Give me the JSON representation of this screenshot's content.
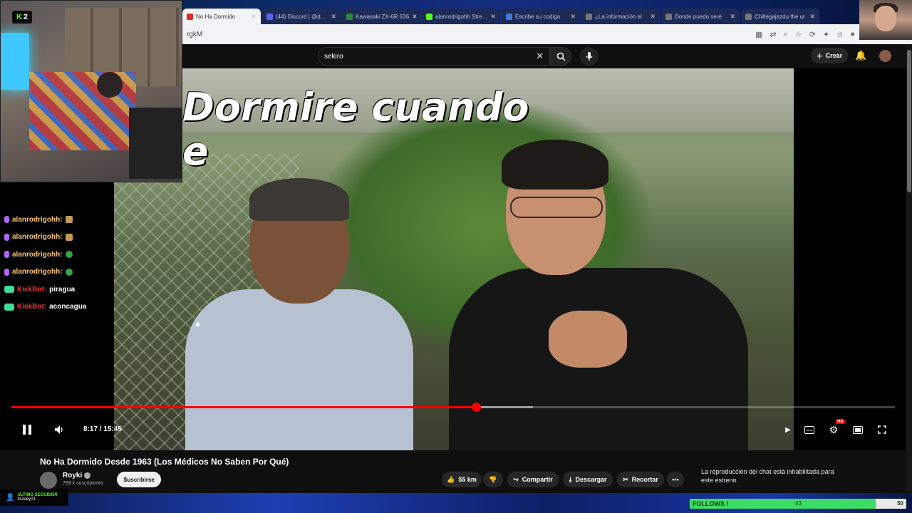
{
  "browser": {
    "tabs": [
      {
        "label": "No Ha Dormido",
        "active": true,
        "color": "#e02a2a"
      },
      {
        "label": "(44) Discord | @d...",
        "active": false,
        "color": "#5865f2"
      },
      {
        "label": "Kawasaki ZX-6R 636",
        "active": false,
        "color": "#2b8a3e"
      },
      {
        "label": "alanrodrigohh Stre...",
        "active": false,
        "color": "#53fc18"
      },
      {
        "label": "Escribe su codigo",
        "active": false,
        "color": "#3a7bd5"
      },
      {
        "label": "¿La información el",
        "active": false,
        "color": "#777777"
      },
      {
        "label": "Donde puedo seré",
        "active": false,
        "color": "#777777"
      },
      {
        "label": "Chillegajazdu the ur",
        "active": false,
        "color": "#777777"
      }
    ],
    "url_fragment": "rgkM"
  },
  "youtube": {
    "search_query": "sekiro",
    "create_label": "Crear"
  },
  "video": {
    "overlay_text_line1": "Dormire cuando",
    "overlay_text_line2": "e",
    "time_display": "8:17 / 15:45",
    "progress_fraction": 0.526,
    "buffer_fraction": 0.59,
    "hd_badge": "HD",
    "title": "No Ha Dormido Desde 1963 (Los Médicos No Saben Por Qué)"
  },
  "channel": {
    "name": "Royki",
    "subscribers": "789 k suscriptores",
    "subscribe_label": "Suscribirse"
  },
  "actions": {
    "like_count": "55 km",
    "share_label": "Compartir",
    "download_label": "Descargar",
    "clip_label": "Recortar"
  },
  "chat_notice": "La reproducción del chat está inhabilitada para este estreno.",
  "stream_overlay": {
    "kick_viewers": "2",
    "chat": [
      {
        "user": "alanrodrigohh:",
        "message": "",
        "emote": "gift",
        "bot": false
      },
      {
        "user": "alanrodrigohh:",
        "message": "",
        "emote": "gift",
        "bot": false
      },
      {
        "user": "alanrodrigohh:",
        "message": "",
        "emote": "green",
        "bot": false
      },
      {
        "user": "alanrodrigohh:",
        "message": "",
        "emote": "green",
        "bot": false
      },
      {
        "user": "KickBot:",
        "message": "piragua",
        "emote": "",
        "bot": true
      },
      {
        "user": "KickBot:",
        "message": "aconcagua",
        "emote": "",
        "bot": true
      }
    ],
    "last_follower_label": "ULTIMO SEGUIDOR",
    "last_follower_name": "itszoey01",
    "follows_label": "FOLLOWS !",
    "follows_current": 43,
    "follows_target": 50
  },
  "colors": {
    "accent_red": "#ff0000",
    "kick_green": "#53fc18"
  }
}
